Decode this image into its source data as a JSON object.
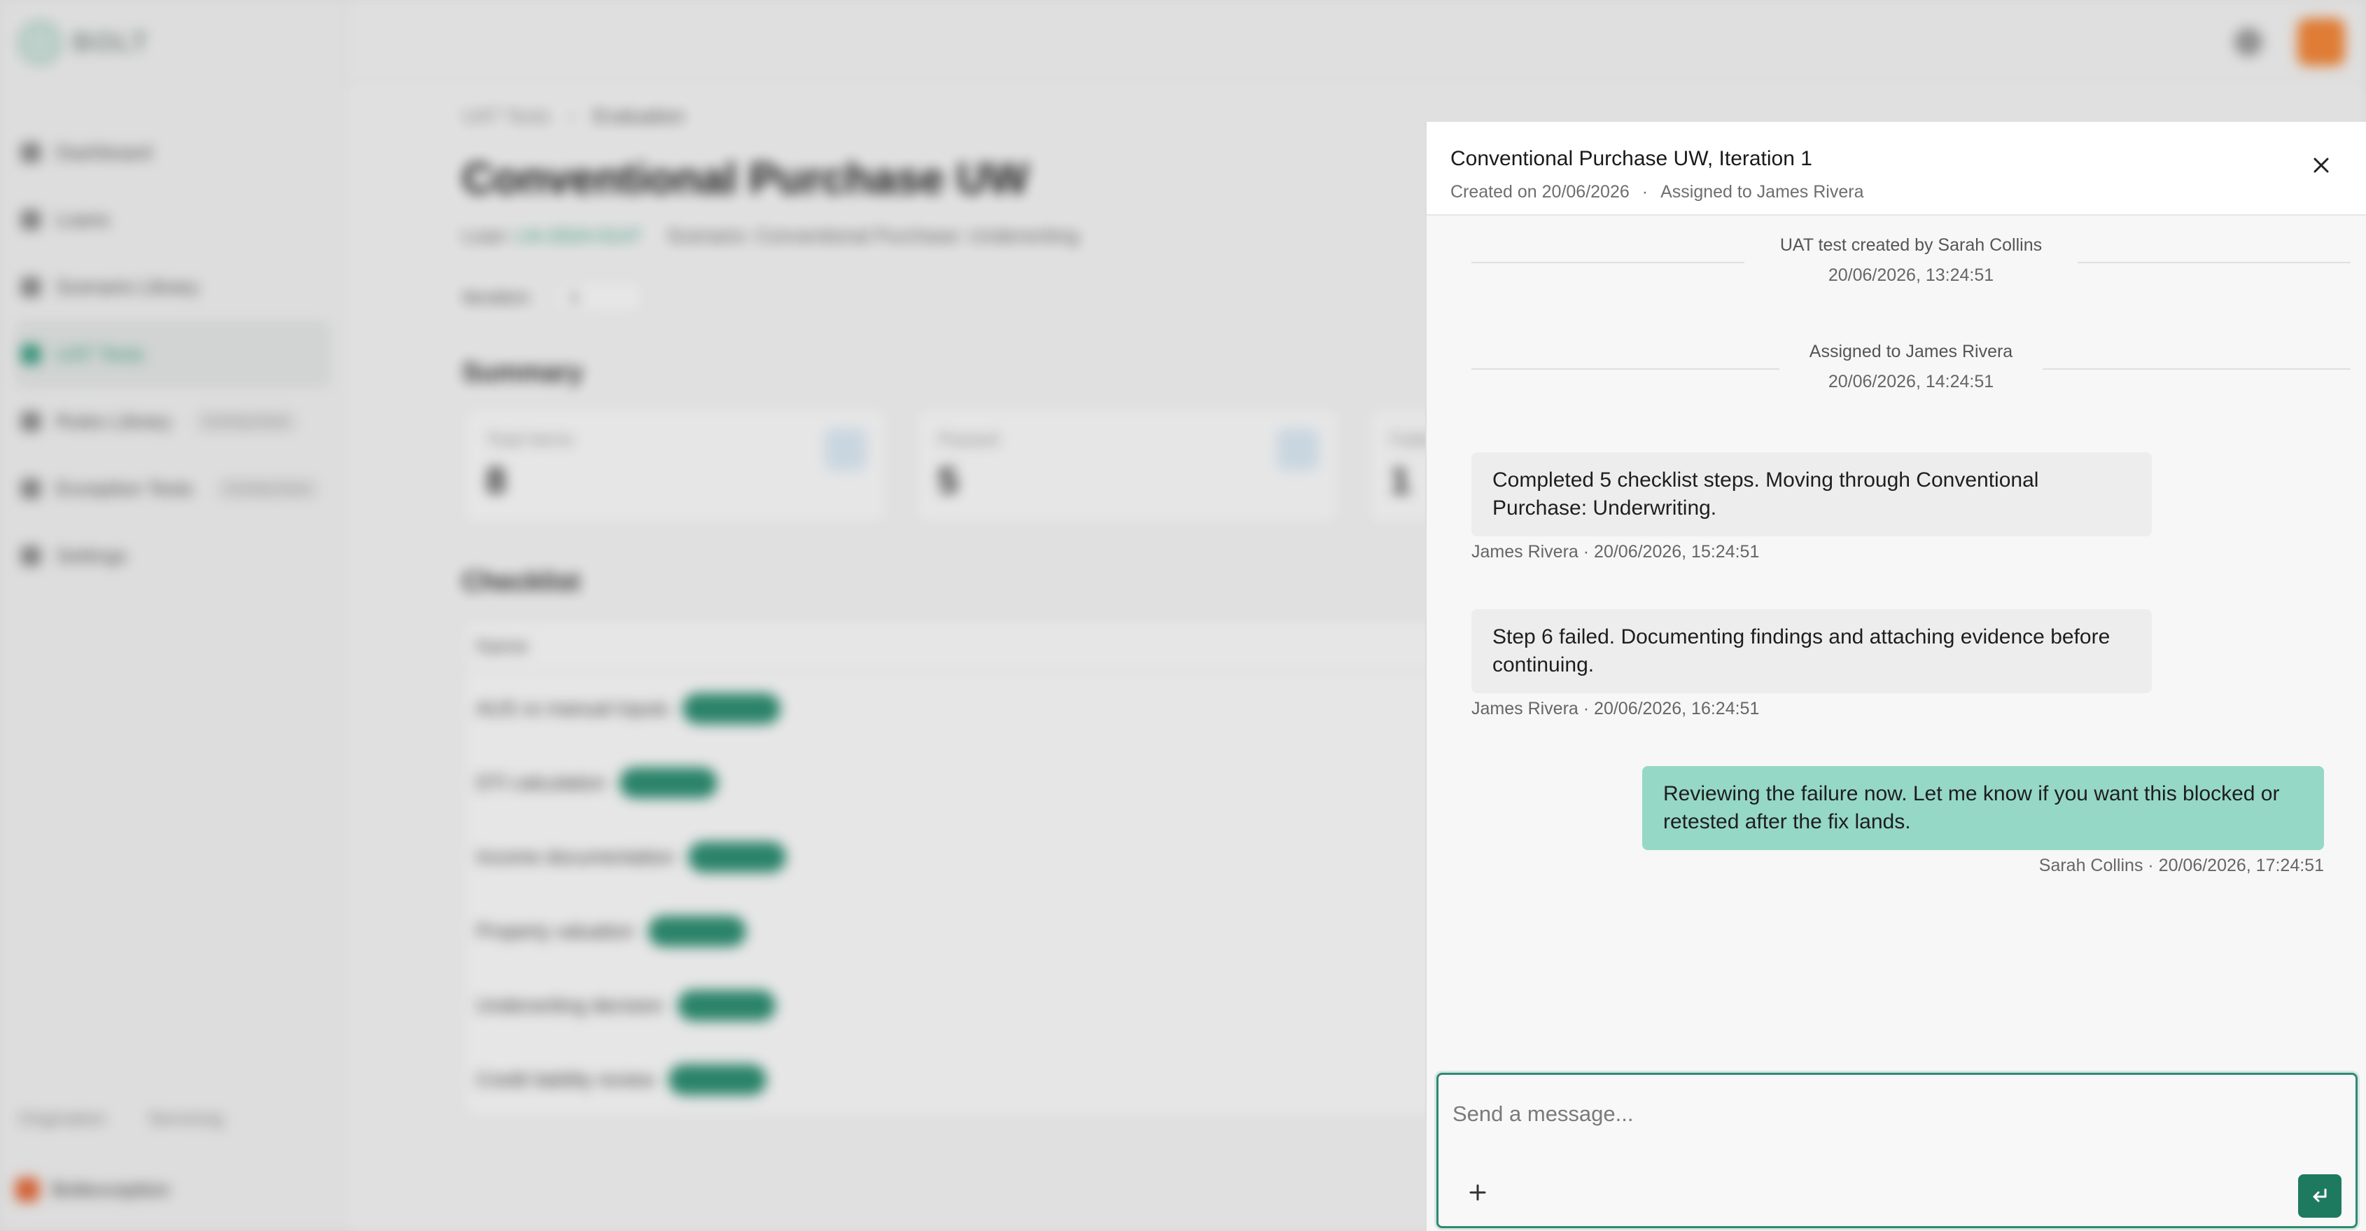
{
  "background": {
    "brand": "BOLT",
    "nav": [
      {
        "label": "Dashboard",
        "tag": ""
      },
      {
        "label": "Loans",
        "tag": ""
      },
      {
        "label": "Scenario Library",
        "tag": ""
      },
      {
        "label": "UAT Tests",
        "tag": ""
      },
      {
        "label": "Rules Library",
        "tag": "Coming Soon"
      },
      {
        "label": "Exception Tests",
        "tag": "Coming Soon"
      },
      {
        "label": "Settings",
        "tag": ""
      }
    ],
    "footer_tabs": [
      "Origination",
      "Servicing"
    ],
    "user": "Boltexception",
    "breadcrumb": {
      "parent": "UAT Tests",
      "sep": "›",
      "current": "Evaluation"
    },
    "title": "Conventional Purchase UW",
    "loan_label": "Loan:",
    "loan_value": "LN-2024-0147",
    "scenario_label": "Scenario:",
    "scenario_value": "Conventional Purchase: Underwriting",
    "iteration_label": "Iteration:",
    "iteration_value": "1",
    "summary_heading": "Summary",
    "cards": [
      {
        "label": "Total Items",
        "value": "8"
      },
      {
        "label": "Passed",
        "value": "5"
      },
      {
        "label": "Failed",
        "value": "1"
      }
    ],
    "checklist_heading": "Checklist",
    "checklist_col": "Name",
    "checklist_rows": [
      "AUS vs manual inputs",
      "DTI calculation",
      "Income documentation",
      "Property valuation",
      "Underwriting decision",
      "Credit liability review"
    ]
  },
  "panel": {
    "title": "Conventional Purchase UW, Iteration 1",
    "created": "Created on 20/06/2026",
    "dot": "·",
    "assigned": "Assigned to James Rivera",
    "events": [
      {
        "text": "UAT test created by Sarah Collins",
        "time": "20/06/2026, 13:24:51"
      },
      {
        "text": "Assigned to James Rivera",
        "time": "20/06/2026, 14:24:51"
      }
    ],
    "messages": [
      {
        "text": "Completed 5 checklist steps. Moving through Conventional Purchase: Underwriting.",
        "meta": "James Rivera · 20/06/2026, 15:24:51"
      },
      {
        "text": "Step 6 failed. Documenting findings and attaching evidence before continuing.",
        "meta": "James Rivera · 20/06/2026, 16:24:51"
      },
      {
        "text": "Reviewing the failure now. Let me know if you want this blocked or retested after the fix lands.",
        "meta": "Sarah Collins · 20/06/2026, 17:24:51"
      }
    ],
    "composer": {
      "placeholder": "Send a message..."
    }
  },
  "colors": {
    "accent": "#1e7a5f",
    "own_bubble": "#95d8c5",
    "other_bubble": "#ededed"
  },
  "icons": {
    "close": "close-icon",
    "add": "plus-icon",
    "send": "enter-icon"
  }
}
